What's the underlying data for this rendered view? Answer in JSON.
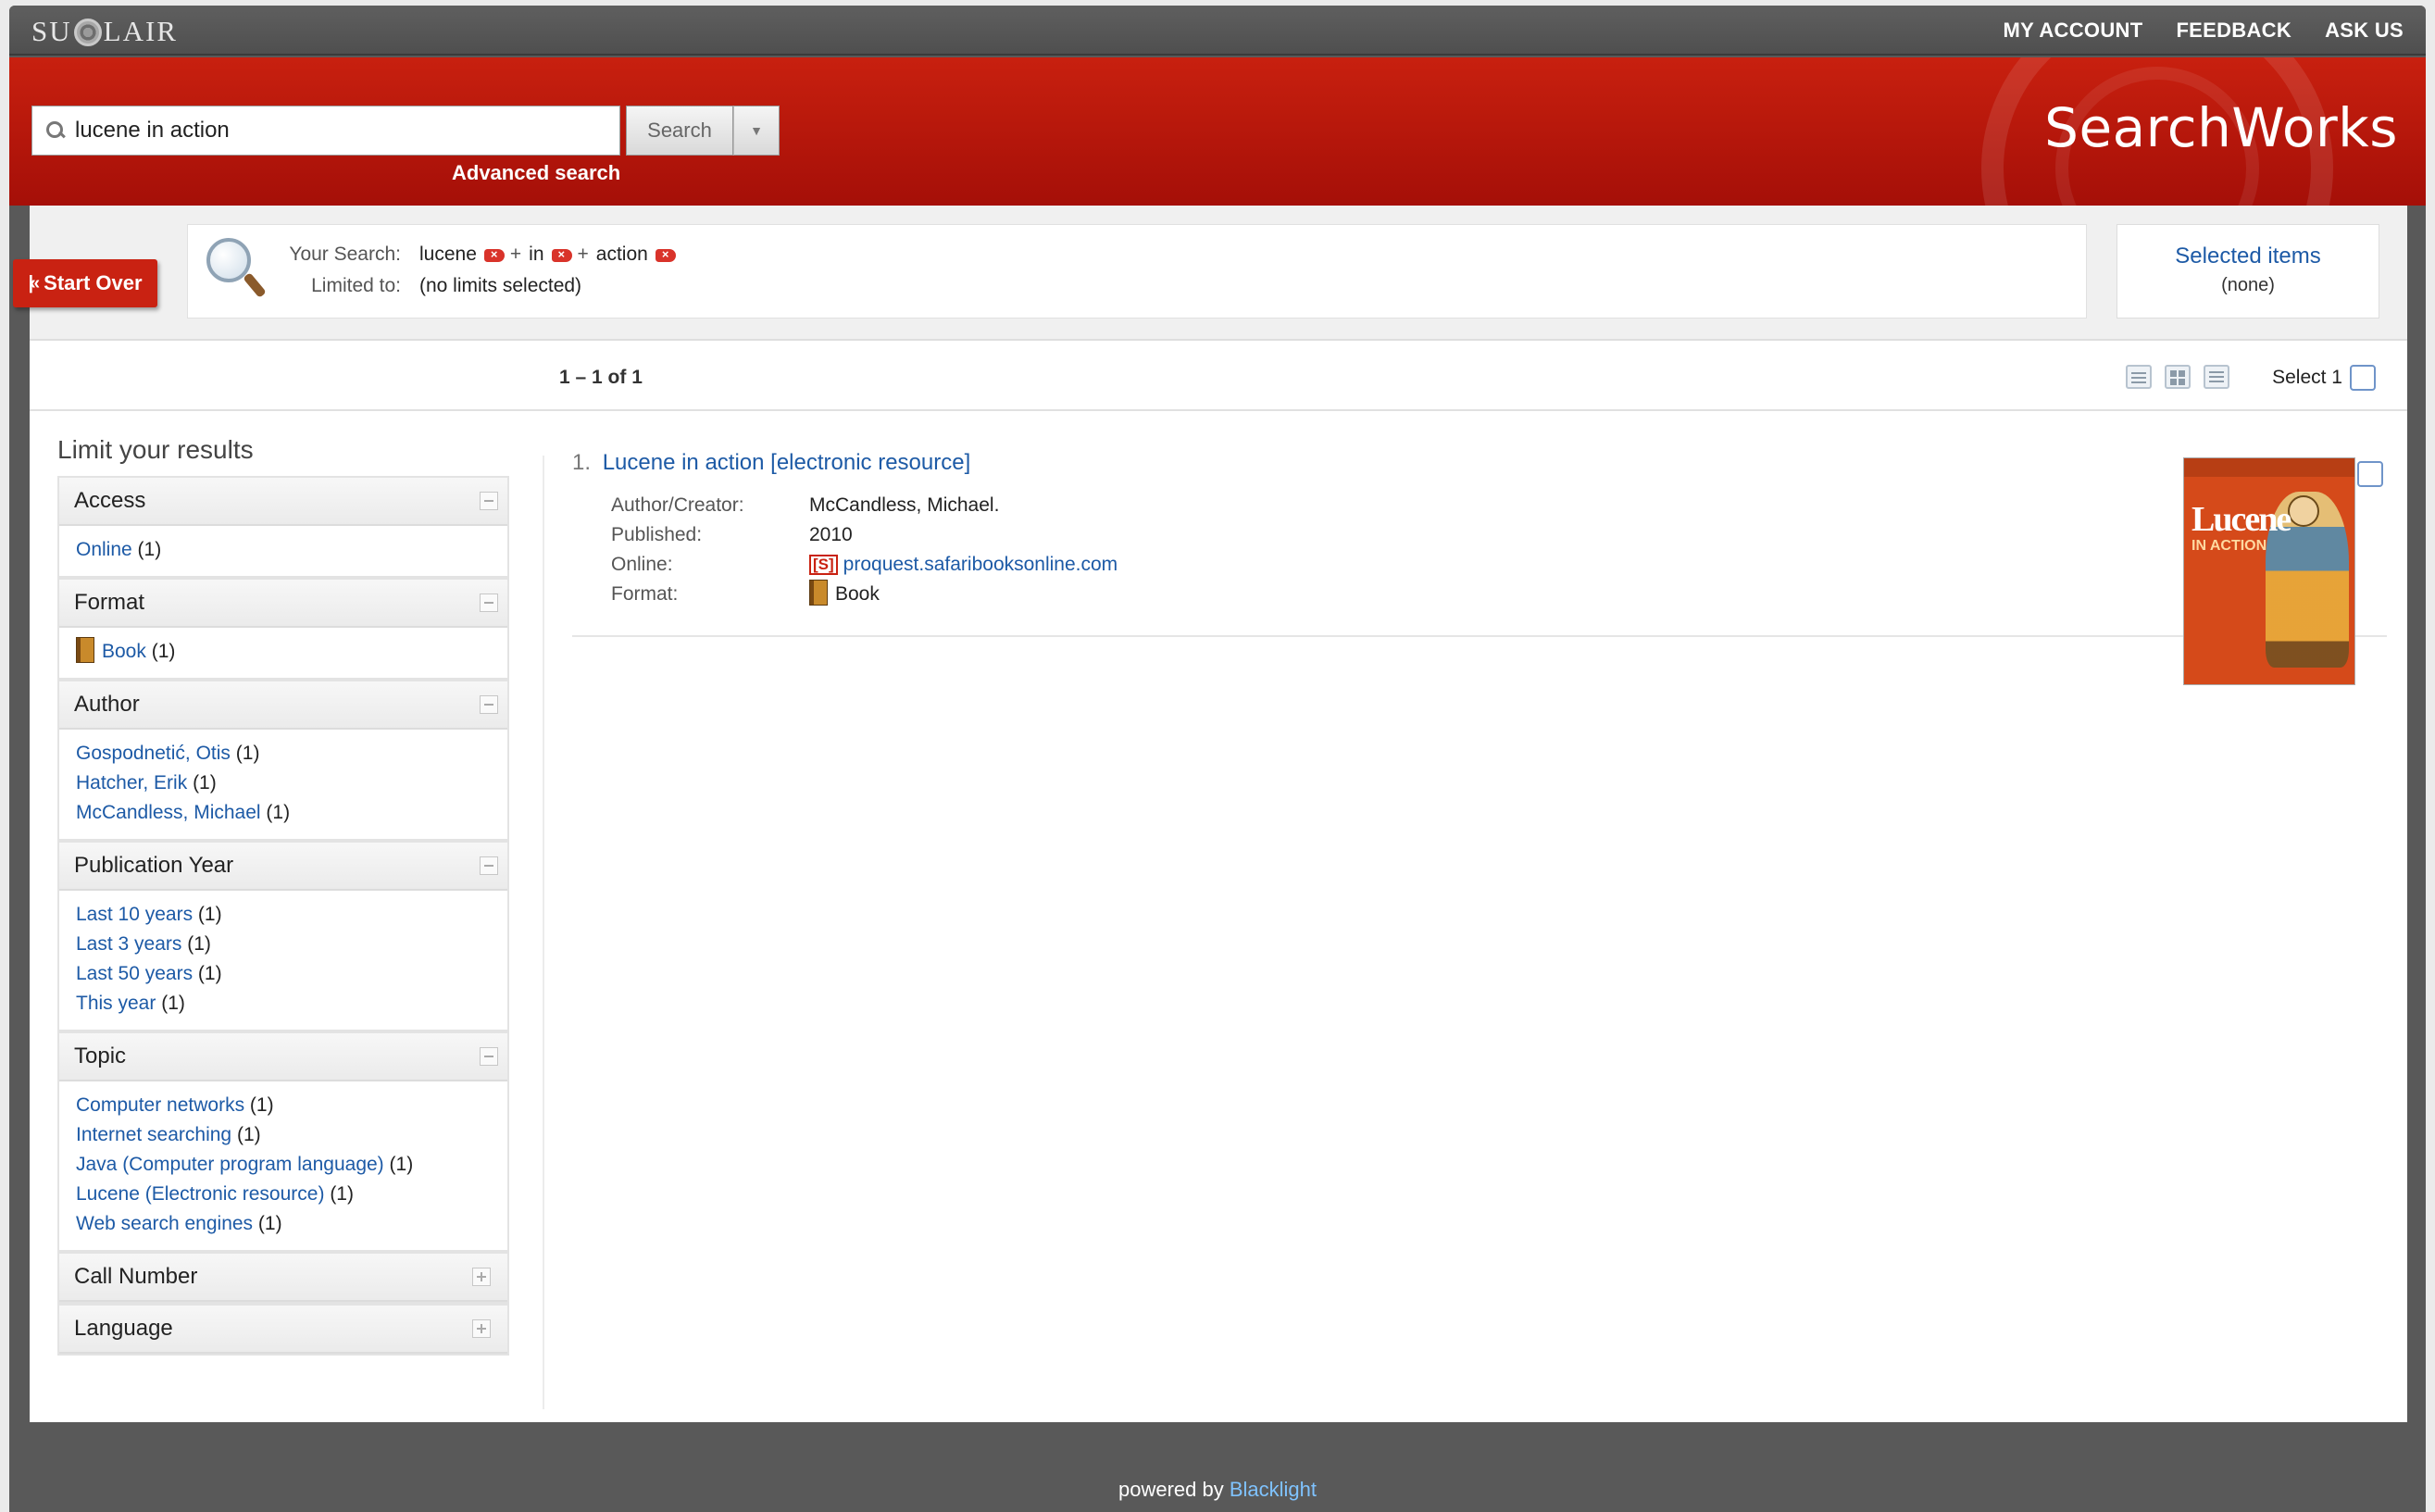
{
  "topbar": {
    "logo_left": "SU",
    "logo_right": "LAIR",
    "links": [
      "MY ACCOUNT",
      "FEEDBACK",
      "ASK US"
    ]
  },
  "header": {
    "brand": "SearchWorks",
    "search_value": "lucene in action",
    "search_button": "Search",
    "advanced_link": "Advanced search"
  },
  "search_summary": {
    "start_over": "Start Over",
    "your_search_label": "Your Search:",
    "terms": [
      "lucene",
      "in",
      "action"
    ],
    "limited_to_label": "Limited to:",
    "limited_to_value": "(no limits selected)",
    "selected_items_label": "Selected items",
    "selected_items_value": "(none)"
  },
  "results_bar": {
    "count": "1 – 1 of 1",
    "select_label": "Select 1"
  },
  "sidebar": {
    "title": "Limit your results",
    "facets": [
      {
        "name": "Access",
        "expanded": true,
        "items": [
          {
            "label": "Online",
            "count": "(1)"
          }
        ]
      },
      {
        "name": "Format",
        "expanded": true,
        "items": [
          {
            "label": "Book",
            "count": "(1)",
            "icon": "book-icon"
          }
        ]
      },
      {
        "name": "Author",
        "expanded": true,
        "items": [
          {
            "label": "Gospodnetić, Otis",
            "count": "(1)"
          },
          {
            "label": "Hatcher, Erik",
            "count": "(1)"
          },
          {
            "label": "McCandless, Michael",
            "count": "(1)"
          }
        ]
      },
      {
        "name": "Publication Year",
        "expanded": true,
        "items": [
          {
            "label": "Last 10 years",
            "count": "(1)"
          },
          {
            "label": "Last 3 years",
            "count": "(1)"
          },
          {
            "label": "Last 50 years",
            "count": "(1)"
          },
          {
            "label": "This year",
            "count": "(1)"
          }
        ]
      },
      {
        "name": "Topic",
        "expanded": true,
        "items": [
          {
            "label": "Computer networks",
            "count": "(1)"
          },
          {
            "label": "Internet searching",
            "count": "(1)"
          },
          {
            "label": "Java (Computer program language)",
            "count": "(1)"
          },
          {
            "label": "Lucene (Electronic resource)",
            "count": "(1)"
          },
          {
            "label": "Web search engines",
            "count": "(1)"
          }
        ]
      },
      {
        "name": "Call Number",
        "expanded": false,
        "items": []
      },
      {
        "name": "Language",
        "expanded": false,
        "items": []
      }
    ]
  },
  "result": {
    "number": "1.",
    "title": "Lucene in action [electronic resource]",
    "fields": [
      {
        "label": "Author/Creator:",
        "value": "McCandless, Michael."
      },
      {
        "label": "Published:",
        "value": "2010"
      },
      {
        "label": "Online:",
        "value": "proquest.safaribooksonline.com",
        "icon": "safari-icon",
        "icon_text": "[S]"
      },
      {
        "label": "Format:",
        "value": "Book",
        "icon": "book-icon"
      }
    ],
    "cover_title": "Lucene",
    "cover_subtitle": "IN ACTION"
  },
  "footer": {
    "prefix": "powered by",
    "link": "Blacklight"
  },
  "colors": {
    "header_red": "#b5150b",
    "link_blue": "#1d5aa6",
    "topbar_gray": "#595959"
  }
}
